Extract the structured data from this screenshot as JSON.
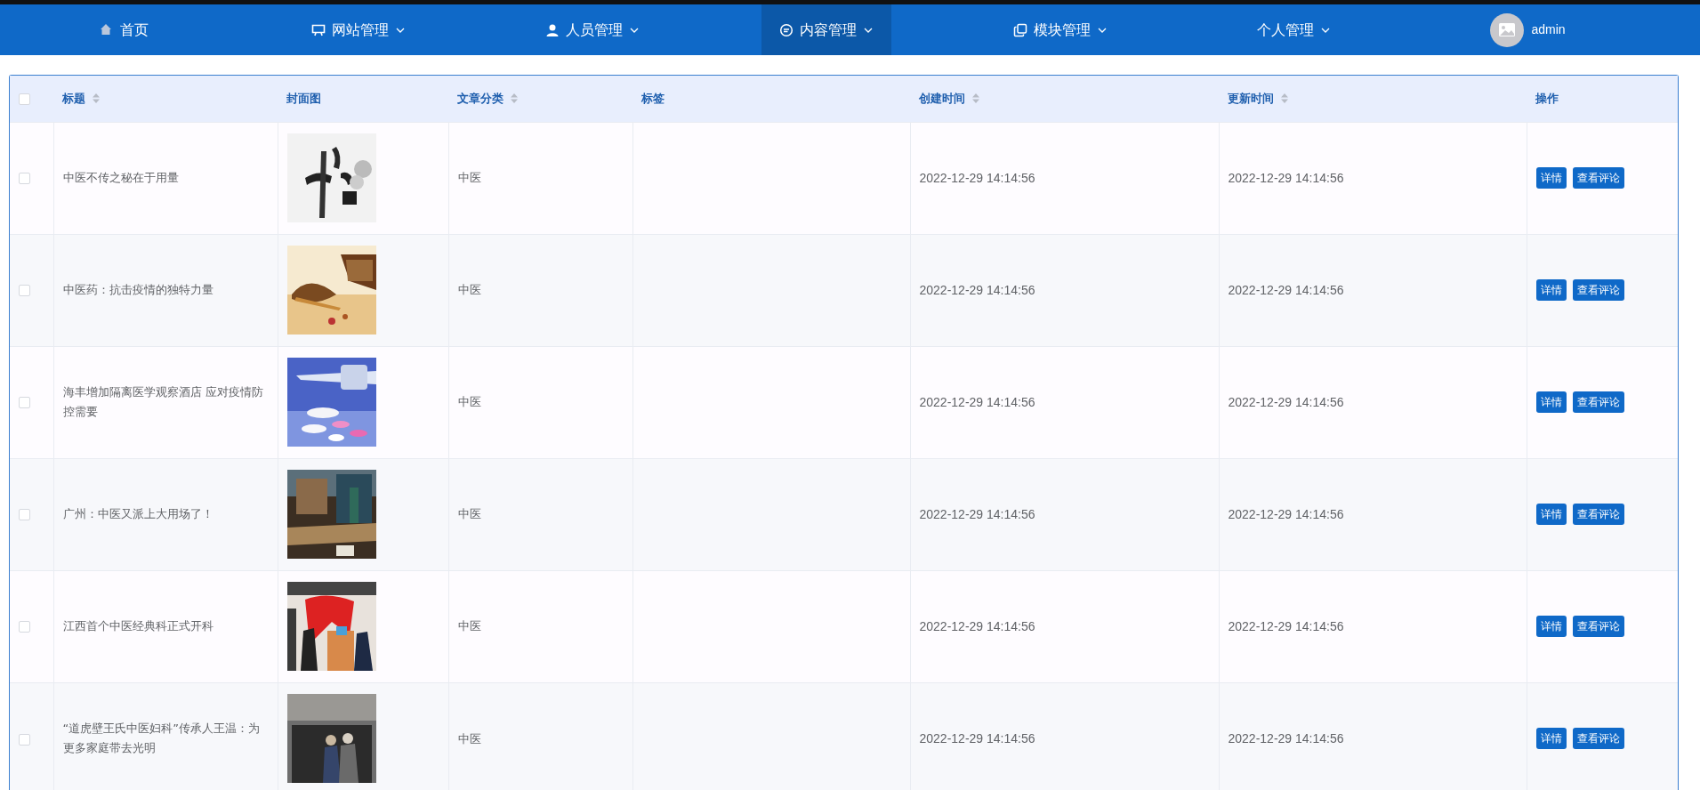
{
  "nav": {
    "items": [
      {
        "label": "首页",
        "dropdown": false,
        "selected": false
      },
      {
        "label": "网站管理",
        "dropdown": true,
        "selected": false
      },
      {
        "label": "人员管理",
        "dropdown": true,
        "selected": false
      },
      {
        "label": "内容管理",
        "dropdown": true,
        "selected": true
      },
      {
        "label": "模块管理",
        "dropdown": true,
        "selected": false
      },
      {
        "label": "个人管理",
        "dropdown": true,
        "selected": false
      }
    ],
    "user": {
      "name": "admin"
    }
  },
  "table": {
    "select_all": {
      "checked": false
    },
    "columns": [
      {
        "label": "标题",
        "sortable": true
      },
      {
        "label": "封面图",
        "sortable": false
      },
      {
        "label": "文章分类",
        "sortable": true
      },
      {
        "label": "标签",
        "sortable": false
      },
      {
        "label": "创建时间",
        "sortable": true
      },
      {
        "label": "更新时间",
        "sortable": true
      },
      {
        "label": "操作",
        "sortable": false
      }
    ],
    "rows": [
      {
        "checked": false,
        "title": "中医不传之秘在于用量",
        "category": "中医",
        "created": "2022-12-29 14:14:56",
        "updated": "2022-12-29 14:14:56",
        "actions": [
          "详情",
          "查看评论"
        ]
      },
      {
        "checked": false,
        "title": "中医药：抗击疫情的独特力量",
        "category": "中医",
        "created": "2022-12-29 14:14:56",
        "updated": "2022-12-29 14:14:56",
        "actions": [
          "详情",
          "查看评论"
        ]
      },
      {
        "checked": false,
        "title": "海丰增加隔离医学观察酒店 应对疫情防控需要",
        "category": "中医",
        "created": "2022-12-29 14:14:56",
        "updated": "2022-12-29 14:14:56",
        "actions": [
          "详情",
          "查看评论"
        ]
      },
      {
        "checked": false,
        "title": "广州：中医又派上大用场了！",
        "category": "中医",
        "created": "2022-12-29 14:14:56",
        "updated": "2022-12-29 14:14:56",
        "actions": [
          "详情",
          "查看评论"
        ]
      },
      {
        "checked": false,
        "title": "江西首个中医经典科正式开科",
        "category": "中医",
        "created": "2022-12-29 14:14:56",
        "updated": "2022-12-29 14:14:56",
        "actions": [
          "详情",
          "查看评论"
        ]
      },
      {
        "checked": false,
        "title": "“道虎壁王氏中医妇科”传承人王温：为更多家庭带去光明",
        "category": "中医",
        "created": "2022-12-29 14:14:56",
        "updated": "2022-12-29 14:14:56",
        "actions": [
          "详情",
          "查看评论"
        ]
      }
    ]
  }
}
